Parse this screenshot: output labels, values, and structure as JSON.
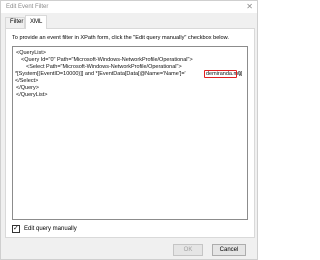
{
  "window": {
    "title": "Edit Event Filter",
    "close_glyph": "✕"
  },
  "tabs": [
    {
      "label": "Filter"
    },
    {
      "label": "XML"
    }
  ],
  "instructions": "To provide an event filter in XPath form, click the \"Edit query manually\" checkbox below.",
  "xml": {
    "lines": [
      "<QueryList>",
      "<Query Id=\"0\" Path=\"Microsoft-Windows-NetworkProfile/Operational\">",
      "<Select Path=\"Microsoft-Windows-NetworkProfile/Operational\">",
      "*[System[(EventID=10000)]] and *[EventData[Data[@Name='Name']='",
      "demiranda.mu",
      "']]",
      "</Select>",
      "</Query>",
      "</QueryList>"
    ],
    "highlight_color": "#e02020"
  },
  "edit_manually": {
    "label": "Edit query manually",
    "checked": true,
    "check_glyph": "✓"
  },
  "buttons": {
    "ok": "OK",
    "cancel": "Cancel"
  }
}
